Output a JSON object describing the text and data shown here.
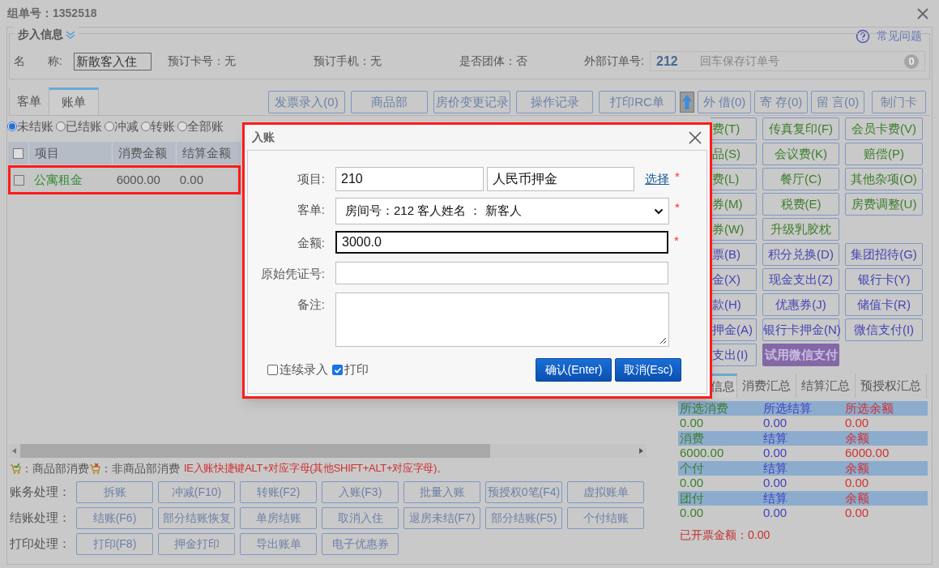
{
  "title": "组单号：1352518",
  "help_link": "常见问题",
  "checkin_info": {
    "legend": "步入信息",
    "name_label": "名　　称:",
    "name_value": "新散客入住",
    "facts": [
      "预订卡号：无",
      "预订手机：无",
      "是否团体：否"
    ],
    "order_label": "外部订单号:",
    "order_value": "212",
    "order_placeholder": "回车保存订单号",
    "order_badge": "0"
  },
  "tabs": [
    {
      "label": "客单",
      "selected": false
    },
    {
      "label": "账单",
      "selected": true
    }
  ],
  "toolbar_left": [
    "发票录入(0)",
    "商品部",
    "房价变更记录",
    "操作记录",
    "打印RC单"
  ],
  "toolbar_right": [
    "外 借(0)",
    "寄 存(0)",
    "留 言(0)",
    "制门卡"
  ],
  "filters": [
    {
      "label": "未结账",
      "selected": true
    },
    {
      "label": "已结账",
      "selected": false
    },
    {
      "label": "冲减",
      "selected": false
    },
    {
      "label": "转账",
      "selected": false
    },
    {
      "label": "全部账",
      "selected": false
    }
  ],
  "table": {
    "header_checked": false,
    "columns": [
      "项目",
      "消费金额",
      "结算金额"
    ],
    "rows": [
      {
        "checked": false,
        "highlighted": true,
        "cells": [
          "公寓租金",
          "6000.00",
          "0.00"
        ]
      }
    ]
  },
  "legend": {
    "goods": "：商品部消费",
    "non_goods": "：非商品部消费",
    "hint": "IE入账快捷键ALT+对应字母(其他SHIFT+ALT+对应字母)。"
  },
  "action_rows": [
    {
      "label": "账务处理：",
      "buttons": [
        "拆账",
        "冲减(F10)",
        "转账(F2)",
        "入账(F3)",
        "批量入账",
        "预授权0笔(F4)",
        "虚拟账单"
      ]
    },
    {
      "label": "结账处理：",
      "buttons": [
        "结账(F6)",
        "部分结账恢复",
        "单房结账",
        "取消入住",
        "退房未结(F7)",
        "部分结账(F5)",
        "个付结账"
      ]
    },
    {
      "label": "打印处理：",
      "buttons": [
        "打印(F8)",
        "押金打印",
        "导出账单",
        "电子优惠券"
      ]
    }
  ],
  "charge_buttons": [
    [
      {
        "label": "费(T)",
        "kind": "charge"
      },
      {
        "label": "传真复印(F)",
        "kind": "charge"
      },
      {
        "label": "会员卡费(V)",
        "kind": "charge"
      }
    ],
    [
      {
        "label": "品(S)",
        "kind": "charge"
      },
      {
        "label": "会议费(K)",
        "kind": "charge"
      },
      {
        "label": "赔偿(P)",
        "kind": "charge"
      }
    ],
    [
      {
        "label": "费(L)",
        "kind": "charge"
      },
      {
        "label": "餐厅(C)",
        "kind": "charge"
      },
      {
        "label": "其他杂项(O)",
        "kind": "charge"
      }
    ],
    [
      {
        "label": "券(M)",
        "kind": "charge"
      },
      {
        "label": "税费(E)",
        "kind": "charge"
      },
      {
        "label": "房费调整(U)",
        "kind": "charge"
      }
    ],
    [
      {
        "label": "券(W)",
        "kind": "charge"
      },
      {
        "label": "升级乳胶枕",
        "kind": "charge"
      }
    ],
    [
      {
        "label": "票(B)",
        "kind": "payment"
      },
      {
        "label": "积分兑换(D)",
        "kind": "payment"
      },
      {
        "label": "集团招待(G)",
        "kind": "payment"
      }
    ],
    [
      {
        "label": "金(X)",
        "kind": "payment"
      },
      {
        "label": "现金支出(Z)",
        "kind": "payment"
      },
      {
        "label": "银行卡(Y)",
        "kind": "payment"
      }
    ],
    [
      {
        "label": "款(H)",
        "kind": "payment"
      },
      {
        "label": "优惠券(J)",
        "kind": "payment"
      },
      {
        "label": "储值卡(R)",
        "kind": "payment"
      }
    ],
    [
      {
        "label": "押金(A)",
        "kind": "payment"
      },
      {
        "label": "银行卡押金(N)",
        "kind": "payment"
      },
      {
        "label": "微信支付(I)",
        "kind": "payment"
      }
    ],
    [
      {
        "label": "支出(I)",
        "kind": "payment"
      },
      {
        "label": "试用微信支付",
        "kind": "promo"
      }
    ]
  ],
  "info_tabs": [
    {
      "label": "信息",
      "selected": true
    },
    {
      "label": "消费汇总",
      "selected": false
    },
    {
      "label": "结算汇总",
      "selected": false
    },
    {
      "label": "预授权汇总",
      "selected": false
    }
  ],
  "summary": [
    {
      "headers": [
        "所选消费",
        "所选结算",
        "所选余额"
      ],
      "values": [
        "0.00",
        "0.00",
        "0.00"
      ]
    },
    {
      "headers": [
        "消费",
        "结算",
        "余额"
      ],
      "values": [
        "6000.00",
        "0.00",
        "6000.00"
      ]
    },
    {
      "headers": [
        "个付",
        "结算",
        "余额"
      ],
      "values": [
        "0.00",
        "0.00",
        "0.00"
      ]
    },
    {
      "headers": [
        "团付",
        "结算",
        "余额"
      ],
      "values": [
        "0.00",
        "0.00",
        "0.00"
      ]
    }
  ],
  "invoiced": "已开票金额：0.00",
  "dialog": {
    "title": "入账",
    "highlighted": true,
    "required_mark": "*",
    "fields": [
      {
        "kind": "item",
        "label": "项目:",
        "code": "210",
        "name": "人民币押金",
        "link": "选择",
        "required": true
      },
      {
        "kind": "select",
        "label": "客单:",
        "value": "房间号：212 客人姓名 ： 新客人",
        "required": true
      },
      {
        "kind": "input",
        "label": "金额:",
        "value": "3000.0",
        "required": true,
        "focused": true
      },
      {
        "kind": "input",
        "label": "原始凭证号:",
        "required": false,
        "focused": false
      },
      {
        "kind": "textarea",
        "label": "备注:",
        "required": false
      }
    ],
    "options": [
      {
        "label": "连续录入",
        "checked": false
      },
      {
        "label": "打印",
        "checked": true
      }
    ],
    "buttons": [
      "确认(Enter)",
      "取消(Esc)"
    ]
  }
}
